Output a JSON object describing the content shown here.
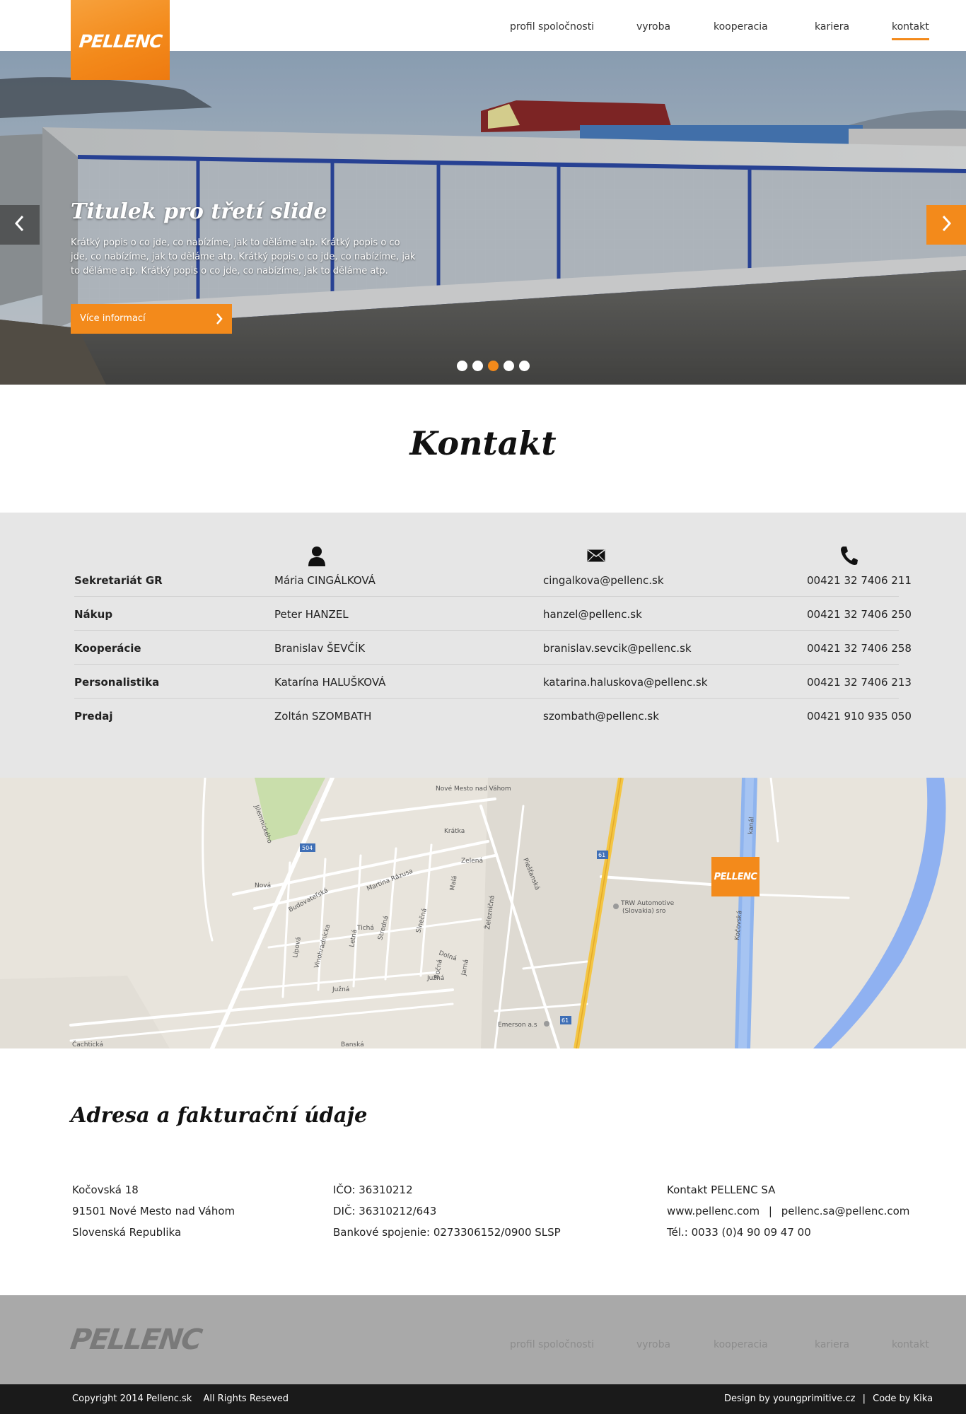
{
  "brand": {
    "logo_text": "PELLENC",
    "accent": "#f38a1b"
  },
  "nav": {
    "items": [
      "profil spoločnosti",
      "vyroba",
      "kooperacia",
      "kariera",
      "kontakt"
    ],
    "active": "kontakt"
  },
  "hero": {
    "title": "Titulek pro třetí slide",
    "description": "Krátký popis o co jde, co nabízíme, jak to děláme atp. Krátký popis o co jde, co nabízíme, jak to děláme atp. Krátký popis o co jde, co nabízíme, jak to děláme atp. Krátký popis o co jde, co nabízíme, jak to děláme atp.",
    "button_label": "Více informací",
    "slide_count": 5,
    "active_slide": 3,
    "prev_icon": "chevron-left-icon",
    "next_icon": "chevron-right-icon"
  },
  "page": {
    "title": "Kontakt"
  },
  "contacts": {
    "icons": [
      "person-icon",
      "envelope-icon",
      "phone-icon"
    ],
    "rows": [
      {
        "department": "Sekretariát GR",
        "name": "Mária CINGÁLKOVÁ",
        "email": "cingalkova@pellenc.sk",
        "phone": "00421 32 7406 211"
      },
      {
        "department": "Nákup",
        "name": "Peter HANZEL",
        "email": "hanzel@pellenc.sk",
        "phone": "00421 32 7406 250"
      },
      {
        "department": "Kooperácie",
        "name": "Branislav ŠEVČÍK",
        "email": "branislav.sevcik@pellenc.sk",
        "phone": "00421 32 7406 258"
      },
      {
        "department": "Personalistika",
        "name": "Katarína HALUŠKOVÁ",
        "email": "katarina.haluskova@pellenc.sk",
        "phone": "00421 32 7406 213"
      },
      {
        "department": "Predaj",
        "name": "Zoltán SZOMBATH",
        "email": "szombath@pellenc.sk",
        "phone": "00421 910 935 050"
      }
    ]
  },
  "map": {
    "pin_label": "PELLENC",
    "labels": {
      "station": "Nové Mesto nad Váhom",
      "trw": "TRW Automotive",
      "trw2": "(Slovakia) sro",
      "emerson": "Emerson a.s",
      "kratka": "Krátka",
      "zelena": "Zelená",
      "nova": "Nová",
      "budovatelska": "Budovateľská",
      "martina": "Martina Rázusa",
      "jilemnickeho": "Jilemnického",
      "tichá": "Tichá",
      "stredna": "Stredná",
      "slnecna": "Slnečná",
      "mala": "Malá",
      "zeleznicna": "Železničná",
      "piestanska": "Piešťanská",
      "dolna": "Dolná",
      "bocna": "Bočná",
      "jarna": "Jarná",
      "juzna": "Južná",
      "juzna2": "Južná",
      "lipova": "Lipová",
      "vinohradnicka": "Vinohradnícka",
      "letna": "Letná",
      "cachticka": "Čachtická",
      "banska": "Banská",
      "kocovska": "Kočovská",
      "kanal": "kanál",
      "route504": "504",
      "route61": "61",
      "route61b": "61"
    }
  },
  "address": {
    "title": "Adresa a fakturační údaje",
    "col1": [
      "Kočovská 18",
      "91501 Nové Mesto nad Váhom",
      "Slovenská Republika"
    ],
    "col2": [
      "IČO: 36310212",
      "DIČ: 36310212/643",
      "Bankové spojenie: 0273306152/0900 SLSP"
    ],
    "contact_title": "Kontakt PELLENC SA",
    "web": "www.pellenc.com",
    "separator": "|",
    "email": "pellenc.sa@pellenc.com",
    "tel": "Tél.: 0033 (0)4 90 09 47 00"
  },
  "footer": {
    "logo_text": "PELLENC",
    "nav": [
      "profil spoločnosti",
      "vyroba",
      "kooperacia",
      "kariera",
      "kontakt"
    ],
    "copyright": "Copyright 2014 Pellenc.sk",
    "rights": "All Rights Reseved",
    "design": "Design by youngprimitive.cz",
    "separator": "|",
    "code": "Code by Kika"
  }
}
